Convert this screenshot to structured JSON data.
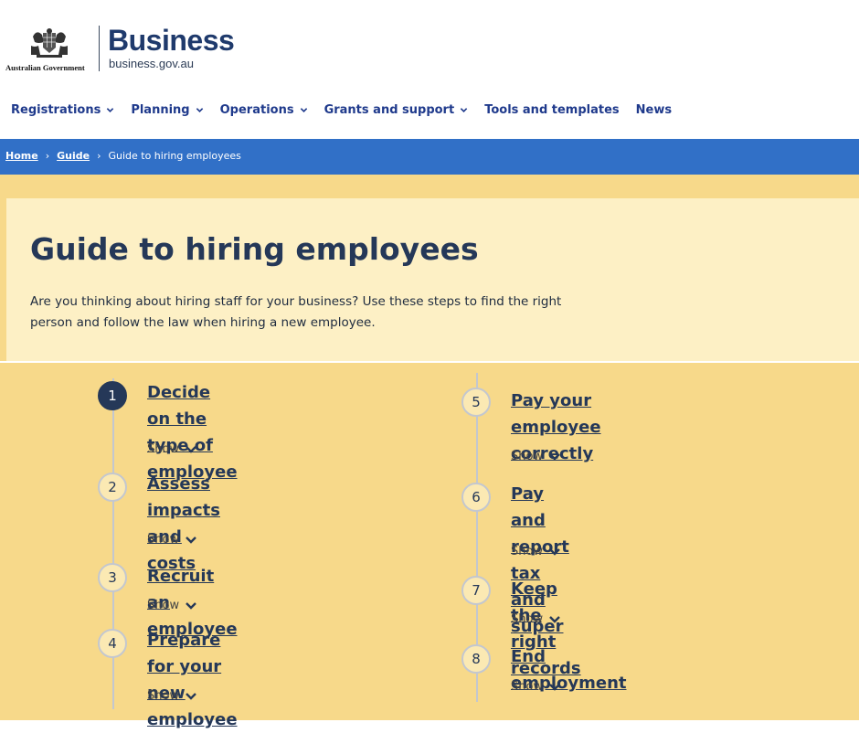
{
  "header": {
    "gov_text": "Australian Government",
    "brand": "Business",
    "brand_url": "business.gov.au"
  },
  "nav": {
    "items": [
      {
        "label": "Registrations",
        "has_dropdown": true
      },
      {
        "label": "Planning",
        "has_dropdown": true
      },
      {
        "label": "Operations",
        "has_dropdown": true
      },
      {
        "label": "Grants and support",
        "has_dropdown": true
      },
      {
        "label": "Tools and templates",
        "has_dropdown": false
      },
      {
        "label": "News",
        "has_dropdown": false
      }
    ]
  },
  "breadcrumb": {
    "home": "Home",
    "guide": "Guide",
    "separator": "›",
    "current": "Guide to hiring employees"
  },
  "hero": {
    "title": "Guide to hiring employees",
    "description": "Are you thinking about hiring staff for your business? Use these steps to find the right person and follow the law when hiring a new employee."
  },
  "steps": [
    {
      "number": "1",
      "line1": "Decide on the type of",
      "line2": "employee",
      "show": "Show",
      "active": true
    },
    {
      "number": "2",
      "line1": "Assess impacts and",
      "line2": "costs",
      "show": "Show",
      "active": false
    },
    {
      "number": "3",
      "line1": "Recruit an employee",
      "line2": "",
      "show": "Show",
      "active": false
    },
    {
      "number": "4",
      "line1": "Prepare for your new",
      "line2": "employee",
      "show": "Show",
      "active": false
    },
    {
      "number": "5",
      "line1": "Pay your employee",
      "line2": "correctly",
      "show": "Show",
      "active": false
    },
    {
      "number": "6",
      "line1": "Pay and report tax and",
      "line2": "super",
      "show": "Show",
      "active": false
    },
    {
      "number": "7",
      "line1": "Keep the right records",
      "line2": "",
      "show": "Show",
      "active": false
    },
    {
      "number": "8",
      "line1": "End employment",
      "line2": "",
      "show": "Show",
      "active": false
    }
  ],
  "colors": {
    "brand_navy": "#1f3a6c",
    "nav_link": "#1f3a8c",
    "breadcrumb_bar": "#3170c7",
    "hero_bg": "#fdf0c5",
    "steps_bg": "#f7d98a",
    "active_step": "#253858"
  }
}
